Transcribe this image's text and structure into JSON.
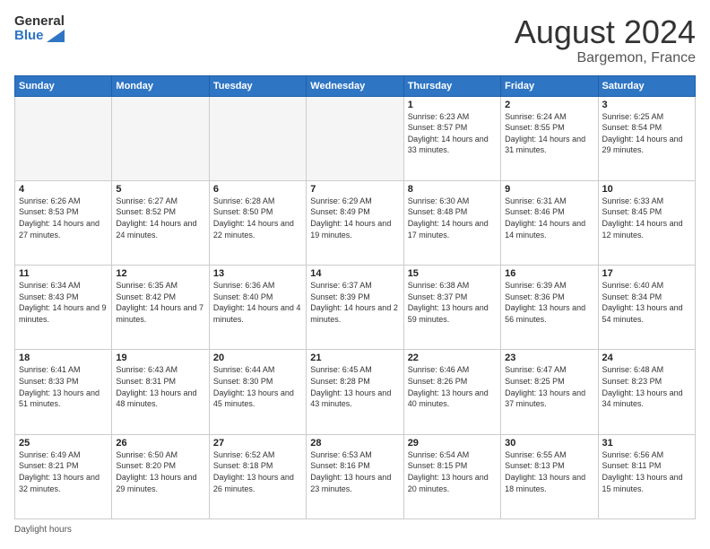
{
  "header": {
    "logo_line1": "General",
    "logo_line2": "Blue",
    "main_title": "August 2024",
    "subtitle": "Bargemon, France"
  },
  "days_of_week": [
    "Sunday",
    "Monday",
    "Tuesday",
    "Wednesday",
    "Thursday",
    "Friday",
    "Saturday"
  ],
  "footer": {
    "label": "Daylight hours"
  },
  "weeks": [
    [
      {
        "day": "",
        "info": ""
      },
      {
        "day": "",
        "info": ""
      },
      {
        "day": "",
        "info": ""
      },
      {
        "day": "",
        "info": ""
      },
      {
        "day": "1",
        "info": "Sunrise: 6:23 AM\nSunset: 8:57 PM\nDaylight: 14 hours and 33 minutes."
      },
      {
        "day": "2",
        "info": "Sunrise: 6:24 AM\nSunset: 8:55 PM\nDaylight: 14 hours and 31 minutes."
      },
      {
        "day": "3",
        "info": "Sunrise: 6:25 AM\nSunset: 8:54 PM\nDaylight: 14 hours and 29 minutes."
      }
    ],
    [
      {
        "day": "4",
        "info": "Sunrise: 6:26 AM\nSunset: 8:53 PM\nDaylight: 14 hours and 27 minutes."
      },
      {
        "day": "5",
        "info": "Sunrise: 6:27 AM\nSunset: 8:52 PM\nDaylight: 14 hours and 24 minutes."
      },
      {
        "day": "6",
        "info": "Sunrise: 6:28 AM\nSunset: 8:50 PM\nDaylight: 14 hours and 22 minutes."
      },
      {
        "day": "7",
        "info": "Sunrise: 6:29 AM\nSunset: 8:49 PM\nDaylight: 14 hours and 19 minutes."
      },
      {
        "day": "8",
        "info": "Sunrise: 6:30 AM\nSunset: 8:48 PM\nDaylight: 14 hours and 17 minutes."
      },
      {
        "day": "9",
        "info": "Sunrise: 6:31 AM\nSunset: 8:46 PM\nDaylight: 14 hours and 14 minutes."
      },
      {
        "day": "10",
        "info": "Sunrise: 6:33 AM\nSunset: 8:45 PM\nDaylight: 14 hours and 12 minutes."
      }
    ],
    [
      {
        "day": "11",
        "info": "Sunrise: 6:34 AM\nSunset: 8:43 PM\nDaylight: 14 hours and 9 minutes."
      },
      {
        "day": "12",
        "info": "Sunrise: 6:35 AM\nSunset: 8:42 PM\nDaylight: 14 hours and 7 minutes."
      },
      {
        "day": "13",
        "info": "Sunrise: 6:36 AM\nSunset: 8:40 PM\nDaylight: 14 hours and 4 minutes."
      },
      {
        "day": "14",
        "info": "Sunrise: 6:37 AM\nSunset: 8:39 PM\nDaylight: 14 hours and 2 minutes."
      },
      {
        "day": "15",
        "info": "Sunrise: 6:38 AM\nSunset: 8:37 PM\nDaylight: 13 hours and 59 minutes."
      },
      {
        "day": "16",
        "info": "Sunrise: 6:39 AM\nSunset: 8:36 PM\nDaylight: 13 hours and 56 minutes."
      },
      {
        "day": "17",
        "info": "Sunrise: 6:40 AM\nSunset: 8:34 PM\nDaylight: 13 hours and 54 minutes."
      }
    ],
    [
      {
        "day": "18",
        "info": "Sunrise: 6:41 AM\nSunset: 8:33 PM\nDaylight: 13 hours and 51 minutes."
      },
      {
        "day": "19",
        "info": "Sunrise: 6:43 AM\nSunset: 8:31 PM\nDaylight: 13 hours and 48 minutes."
      },
      {
        "day": "20",
        "info": "Sunrise: 6:44 AM\nSunset: 8:30 PM\nDaylight: 13 hours and 45 minutes."
      },
      {
        "day": "21",
        "info": "Sunrise: 6:45 AM\nSunset: 8:28 PM\nDaylight: 13 hours and 43 minutes."
      },
      {
        "day": "22",
        "info": "Sunrise: 6:46 AM\nSunset: 8:26 PM\nDaylight: 13 hours and 40 minutes."
      },
      {
        "day": "23",
        "info": "Sunrise: 6:47 AM\nSunset: 8:25 PM\nDaylight: 13 hours and 37 minutes."
      },
      {
        "day": "24",
        "info": "Sunrise: 6:48 AM\nSunset: 8:23 PM\nDaylight: 13 hours and 34 minutes."
      }
    ],
    [
      {
        "day": "25",
        "info": "Sunrise: 6:49 AM\nSunset: 8:21 PM\nDaylight: 13 hours and 32 minutes."
      },
      {
        "day": "26",
        "info": "Sunrise: 6:50 AM\nSunset: 8:20 PM\nDaylight: 13 hours and 29 minutes."
      },
      {
        "day": "27",
        "info": "Sunrise: 6:52 AM\nSunset: 8:18 PM\nDaylight: 13 hours and 26 minutes."
      },
      {
        "day": "28",
        "info": "Sunrise: 6:53 AM\nSunset: 8:16 PM\nDaylight: 13 hours and 23 minutes."
      },
      {
        "day": "29",
        "info": "Sunrise: 6:54 AM\nSunset: 8:15 PM\nDaylight: 13 hours and 20 minutes."
      },
      {
        "day": "30",
        "info": "Sunrise: 6:55 AM\nSunset: 8:13 PM\nDaylight: 13 hours and 18 minutes."
      },
      {
        "day": "31",
        "info": "Sunrise: 6:56 AM\nSunset: 8:11 PM\nDaylight: 13 hours and 15 minutes."
      }
    ]
  ]
}
